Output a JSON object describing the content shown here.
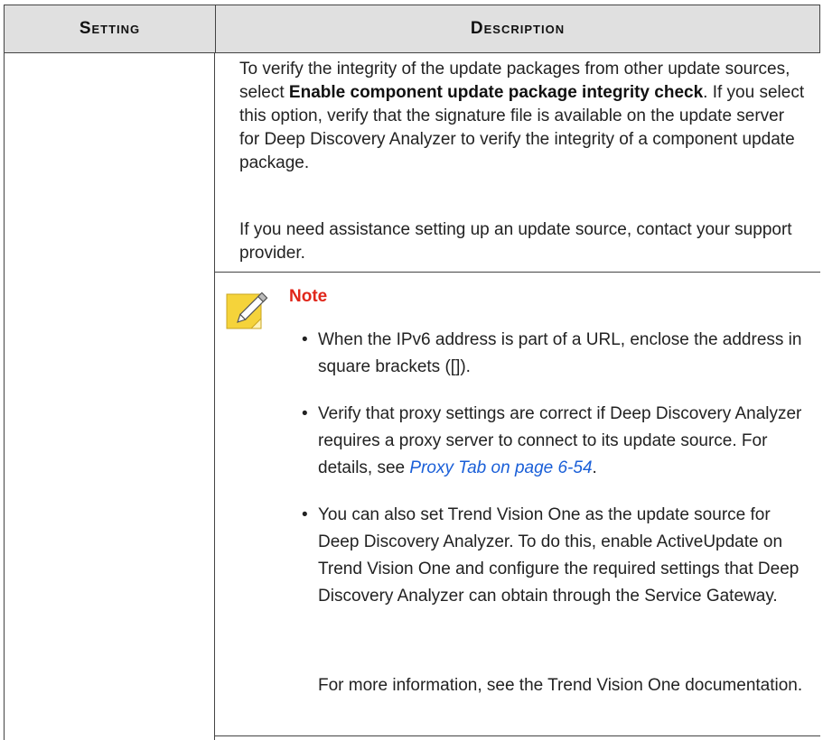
{
  "table": {
    "header": {
      "setting": "Setting",
      "description": "Description"
    }
  },
  "description": {
    "p1_a": "To verify the integrity of the update packages from other update sources, select ",
    "p1_bold": "Enable component update package integrity check",
    "p1_b": ". If you select this option, verify that the signature file is available on the update server for Deep Discovery Analyzer to verify the integrity of a component update package.",
    "p2": "If you need assistance setting up an update source, contact your support provider."
  },
  "note": {
    "title": "Note",
    "icon": "note-pencil-icon",
    "bullet1": "When the IPv6 address is part of a URL, enclose the address in square brackets ([]).",
    "bullet2_a": "Verify that proxy settings are correct if Deep Discovery Analyzer requires a proxy server to connect to its update source. For details, see ",
    "bullet2_link": "Proxy Tab on page 6-54",
    "bullet2_b": ".",
    "bullet3": "You can also set Trend Vision One as the update source for Deep Discovery Analyzer. To do this, enable ActiveUpdate on Trend Vision One and configure the required settings that Deep Discovery Analyzer can obtain through the Service Gateway.",
    "after": "For more information, see the Trend Vision One documentation."
  },
  "colors": {
    "note_title": "#e0261a",
    "link": "#1a5fd8",
    "header_bg": "#e0e0e0",
    "icon_yellow": "#f5d33a"
  }
}
